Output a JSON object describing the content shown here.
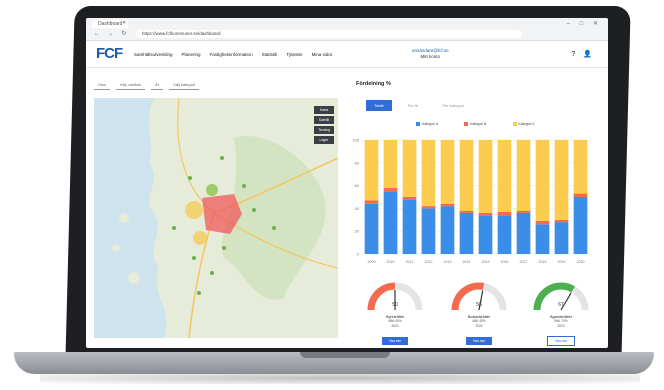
{
  "browser": {
    "tab_title": "Dashboard",
    "address": "https://www.fcfkommuner.se/dashboard",
    "nav_glyphs": "← → ↻",
    "window_glyphs": "– □ ✕"
  },
  "header": {
    "logo": "FCF",
    "nav": [
      "Samhällsutveckling",
      "Planering",
      "Fastighetsinformation",
      "Statistik",
      "Tjänster",
      "Mina sidor"
    ],
    "user_email": "användare@fcf.se",
    "user_sub": "Mitt konto",
    "icons": [
      "help-icon",
      "user-icon"
    ]
  },
  "filters": [
    "Visa",
    "Välj område",
    "År",
    "Välj kategori"
  ],
  "map": {
    "controls": [
      "Karta",
      "Satellit",
      "Terräng",
      "Lager"
    ]
  },
  "chart": {
    "title": "Fördelning %",
    "tabs": [
      "Totalt",
      "Per år",
      "Per kategori"
    ],
    "active_tab": 0,
    "legend": [
      "Kategori A",
      "Kategori B",
      "Kategori C"
    ],
    "colors": [
      "#3b8ee8",
      "#f26b50",
      "#fccc4e"
    ]
  },
  "chart_data": {
    "type": "bar",
    "stacked": true,
    "categories": [
      "2009",
      "2010",
      "2011",
      "2012",
      "2013",
      "2014",
      "2015",
      "2016",
      "2017",
      "2018",
      "2019",
      "2020"
    ],
    "series": [
      {
        "name": "Kategori A",
        "values": [
          44,
          55,
          48,
          40,
          42,
          36,
          34,
          34,
          36,
          26,
          28,
          50
        ]
      },
      {
        "name": "Kategori B",
        "values": [
          3,
          3,
          2,
          2,
          2,
          2,
          2,
          3,
          2,
          3,
          2,
          3
        ]
      },
      {
        "name": "Kategori C",
        "values": [
          53,
          42,
          50,
          58,
          56,
          62,
          64,
          63,
          62,
          71,
          70,
          47
        ]
      }
    ],
    "ylim": [
      0,
      100
    ],
    "yticks": [
      "0",
      "20",
      "40",
      "60",
      "80",
      "100"
    ],
    "grid": true
  },
  "gauges": [
    {
      "value": "50",
      "label": "Hyresrätter",
      "sub1": "Mål: 60%",
      "sub2": "2020",
      "button": "Visa mer",
      "fraction": 0.5,
      "fill": "#f26b50"
    },
    {
      "value": "56",
      "label": "Bostadsrätter",
      "sub1": "Mål: 45%",
      "sub2": "2020",
      "button": "Visa mer",
      "fraction": 0.56,
      "fill": "#f26b50"
    },
    {
      "value": "67",
      "label": "Äganderätter",
      "sub1": "Mål: 70%",
      "sub2": "2020",
      "button": "Visa mer",
      "fraction": 0.67,
      "fill": "#4caf50"
    }
  ]
}
